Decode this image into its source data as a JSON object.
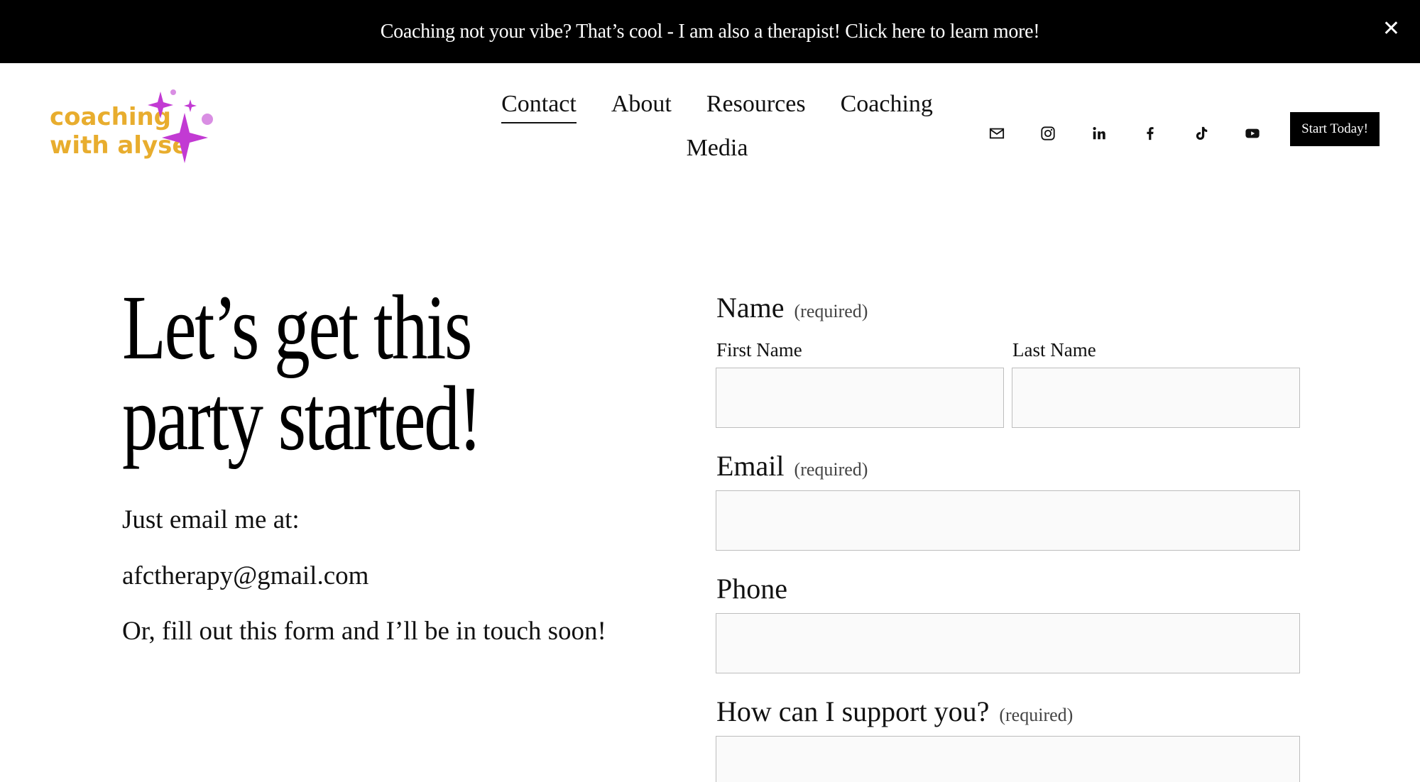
{
  "banner": {
    "text": "Coaching not your vibe? That’s cool - I am also a therapist! Click here to learn more!",
    "close_icon": "close-icon",
    "close_glyph": "✕"
  },
  "logo": {
    "line1": "coaching",
    "line2": "with alyse",
    "text_color": "#e8ad2e",
    "sparkle_color": "#c23ad3"
  },
  "nav": {
    "row1": [
      "Contact",
      "About",
      "Resources",
      "Coaching"
    ],
    "row2": [
      "Media"
    ],
    "active": "Contact"
  },
  "socials": [
    "mail-icon",
    "instagram-icon",
    "linkedin-icon",
    "facebook-icon",
    "tiktok-icon",
    "youtube-icon"
  ],
  "cta_label": "Start Today!",
  "hero": {
    "headline_line1": "Let’s get this",
    "headline_line2": "party started!",
    "intro": "Just email me at:",
    "email": "afctherapy@gmail.com",
    "outro": "Or, fill out this form and I’ll be in touch soon!"
  },
  "form": {
    "name_label": "Name",
    "required_text": "(required)",
    "first_name_label": "First Name",
    "last_name_label": "Last Name",
    "email_label": "Email",
    "phone_label": "Phone",
    "support_label": "How can I support you?"
  }
}
